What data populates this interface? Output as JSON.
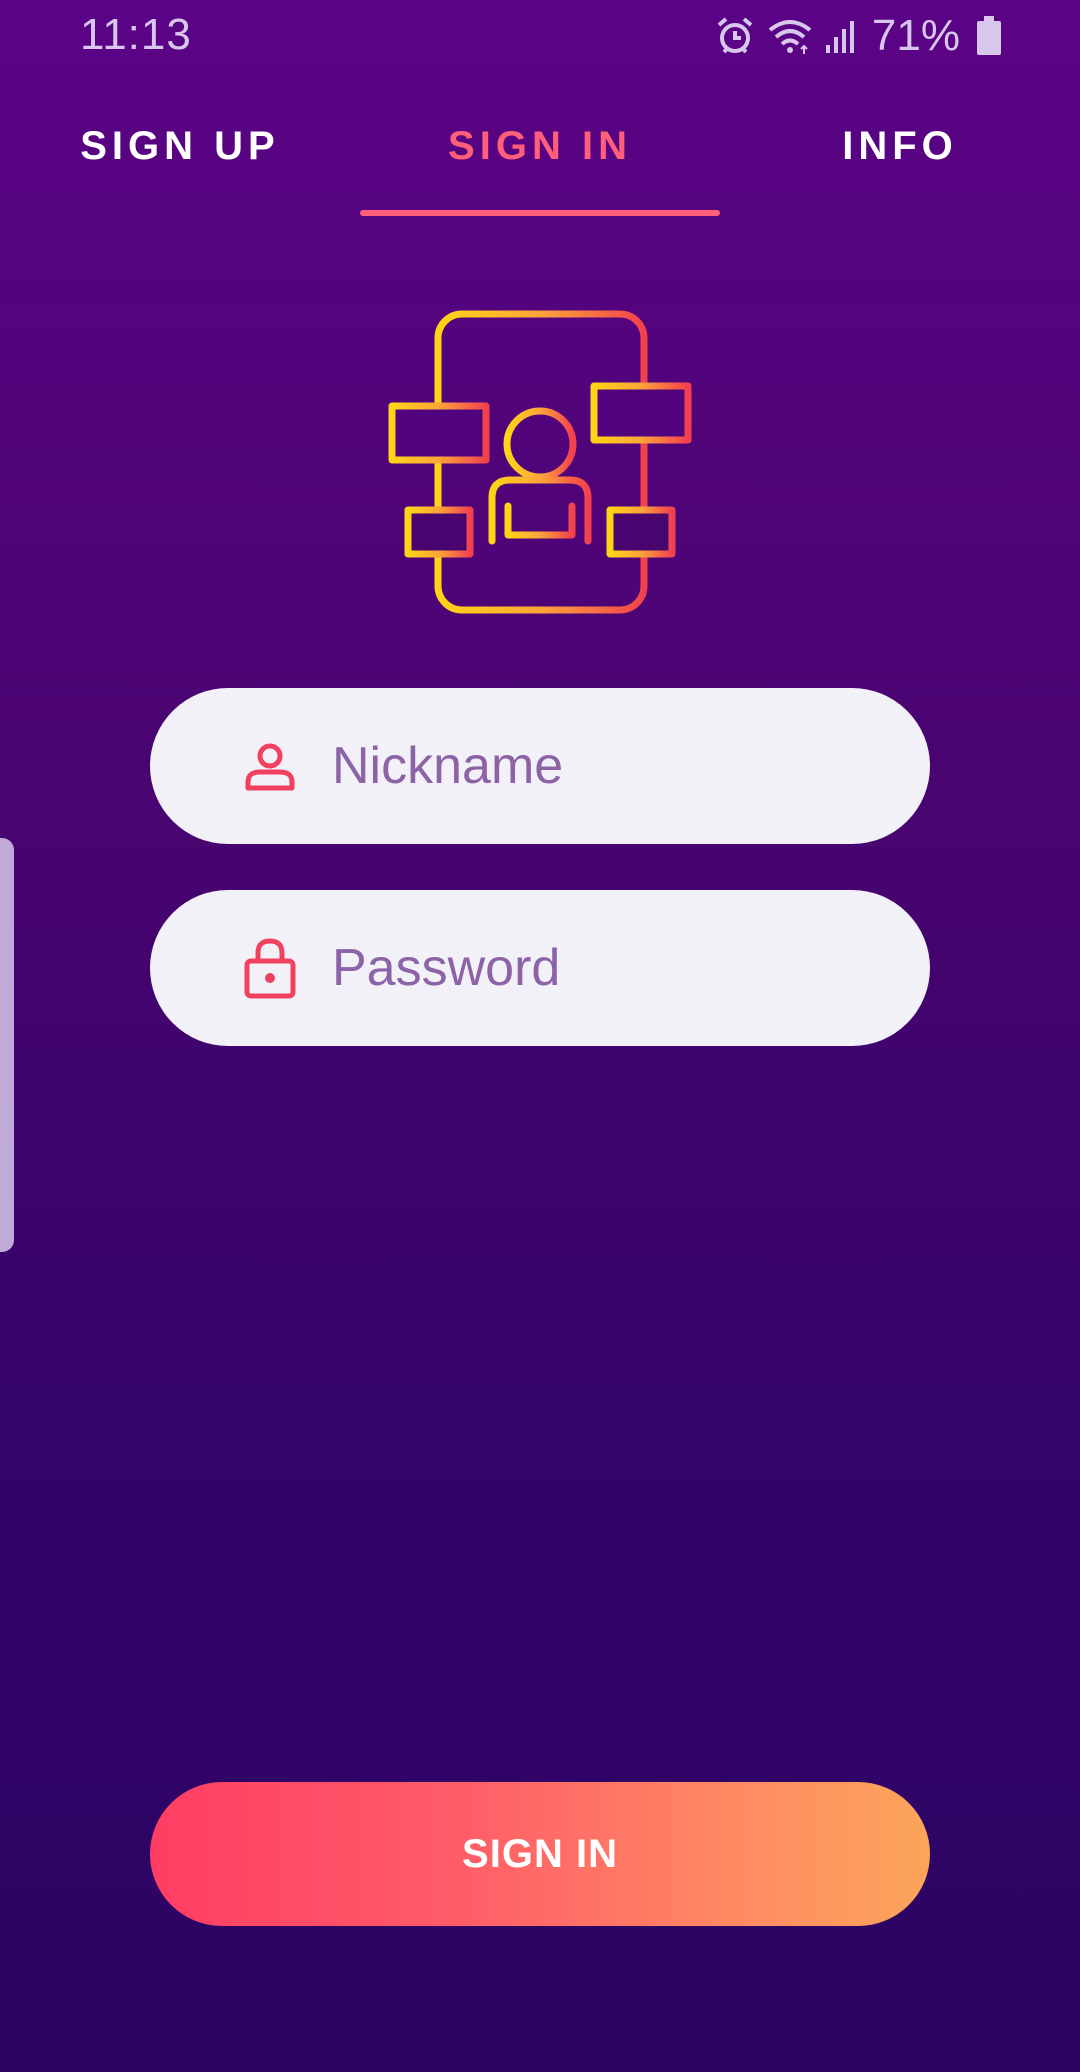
{
  "status_bar": {
    "time": "11:13",
    "battery_percent": "71%",
    "icons": [
      "alarm-icon",
      "wifi-icon",
      "signal-icon",
      "battery-icon"
    ]
  },
  "tabs": [
    {
      "label": "SIGN UP",
      "active": false
    },
    {
      "label": "SIGN IN",
      "active": true
    },
    {
      "label": "INFO",
      "active": false
    }
  ],
  "form": {
    "nickname": {
      "placeholder": "Nickname",
      "icon": "user-icon"
    },
    "password": {
      "placeholder": "Password",
      "icon": "lock-icon"
    }
  },
  "submit_label": "SIGN IN",
  "illustration": {
    "icon": "phone-user-interface-icon"
  },
  "colors": {
    "accent": "#ff5f78",
    "background_top": "#5b0386",
    "background_bottom": "#2b0462",
    "field_background": "#f3f1f8",
    "placeholder_text": "#8b63a6",
    "button_gradient_start": "#ff3d63",
    "button_gradient_end": "#fca55a"
  }
}
